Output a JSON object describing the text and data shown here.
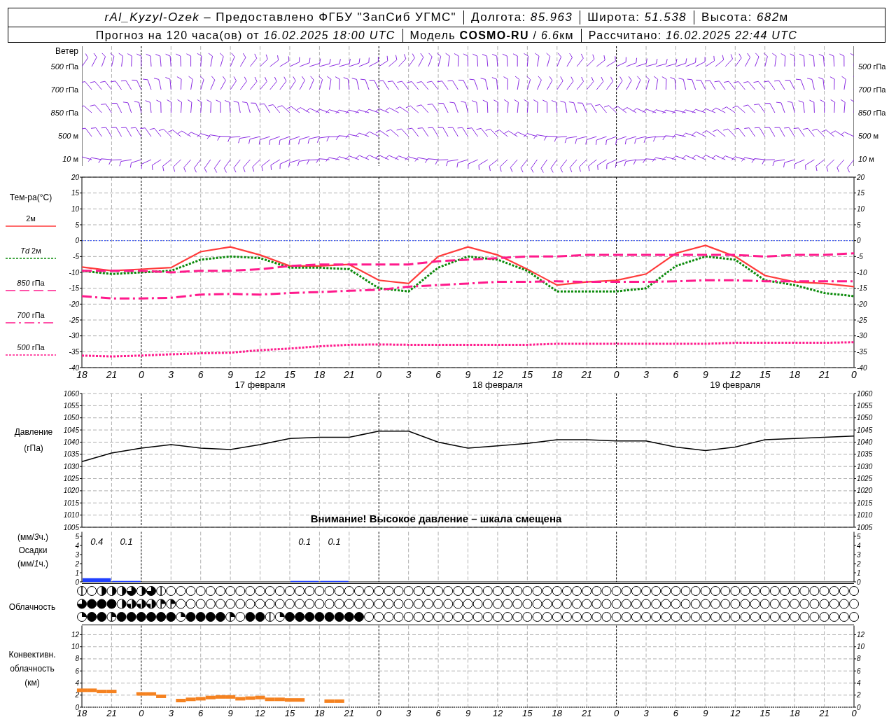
{
  "header": {
    "row1": [
      "*rAl_Kyzyl-Ozek* – Предоставлено ФГБУ \"ЗапСиб УГМС\"",
      "Долгота: *85.963*",
      "Широта: *51.538*",
      [
        "Высота: ",
        "682",
        "м"
      ]
    ],
    "row2": [
      "Прогноз на 120 часа(ов) от *16.02.2025 18:00 UTC*",
      [
        "Модель ",
        "COSMO-RU",
        " / ",
        "6.6",
        "км"
      ],
      "Рассчитано: *16.02.2025 22:44 UTC*"
    ]
  },
  "wind": {
    "title": "Ветер",
    "levels_left": [
      "*500* гПа",
      "*700* гПа",
      "*850* гПа",
      "*500* м",
      "*10* м"
    ],
    "levels_right": [
      "*500* гПа",
      "*700* гПа",
      "*850* гПа",
      "*500* м",
      "*10* м"
    ]
  },
  "temperature": {
    "label": "Тем-ра(°С)",
    "day_labels": [
      "17 февраля",
      "18 февраля",
      "19 февраля"
    ],
    "right_ticks": [
      "20",
      "15",
      "10",
      "5",
      "0",
      "-5",
      "-10",
      "-15",
      "-20",
      "-25",
      "-30",
      "-35",
      "-40"
    ],
    "chart_data": {
      "type": "line",
      "grid": true,
      "ylim": [
        -40,
        20
      ],
      "yticks": [
        20,
        15,
        10,
        5,
        0,
        -5,
        -10,
        -15,
        -20,
        -25,
        -30,
        -35,
        -40
      ],
      "categories": [
        "18",
        "21",
        "0",
        "3",
        "6",
        "9",
        "12",
        "15",
        "18",
        "21",
        "0",
        "3",
        "6",
        "9",
        "12",
        "15",
        "18",
        "21",
        "0",
        "3",
        "6",
        "9",
        "12",
        "15",
        "18",
        "21",
        "0"
      ],
      "series": [
        {
          "name": "2м",
          "line_style": "solid",
          "color": "#ff3b3b",
          "values": [
            -8.3,
            -9.5,
            -9,
            -8.5,
            -3.5,
            -2,
            -4.5,
            -8,
            -8,
            -7.5,
            -12.5,
            -13.5,
            -5,
            -2,
            -4.5,
            -9,
            -14,
            -13,
            -12.5,
            -10.5,
            -4,
            -1.5,
            -5,
            -11,
            -13,
            -13.5,
            -14.5
          ]
        },
        {
          "name": "*Td* 2м",
          "line_style": "dotted",
          "color": "#0a8a0a",
          "values": [
            -9.5,
            -10.5,
            -10,
            -9.5,
            -6,
            -5,
            -5.5,
            -8.5,
            -8.5,
            -9,
            -15,
            -16,
            -8.5,
            -5,
            -6,
            -9.5,
            -16,
            -16,
            -16,
            -15,
            -8,
            -5,
            -6,
            -12.5,
            -14,
            -16.5,
            -17.5
          ]
        },
        {
          "name": "*850* гПа",
          "line_style": "dashed",
          "color": "#ff1a8c",
          "values": [
            -9.5,
            -9.5,
            -9.5,
            -10,
            -9.5,
            -9.5,
            -9,
            -8,
            -7.5,
            -7.5,
            -7.5,
            -7.5,
            -6.5,
            -6,
            -5.5,
            -5,
            -5,
            -4.5,
            -4.5,
            -4.5,
            -4.5,
            -4.5,
            -4.5,
            -5,
            -4.5,
            -4.5,
            -4
          ]
        },
        {
          "name": "*700* гПа",
          "line_style": "dashdot",
          "color": "#ff1a8c",
          "values": [
            -17.5,
            -18.2,
            -18.2,
            -18,
            -17,
            -16.8,
            -17,
            -16.5,
            -16.2,
            -15.8,
            -15.5,
            -14.5,
            -14,
            -13.5,
            -13,
            -13,
            -12.8,
            -13,
            -13,
            -13,
            -12.8,
            -12.5,
            -12.5,
            -12.8,
            -12.8,
            -12.8,
            -12.8
          ]
        },
        {
          "name": "*500* гПа",
          "line_style": "dotted",
          "color": "#ff1a8c",
          "values": [
            -36.2,
            -36.5,
            -36.2,
            -35.8,
            -35.5,
            -35.3,
            -34.5,
            -34,
            -33.3,
            -32.8,
            -32.7,
            -32.8,
            -32.8,
            -32.8,
            -32.8,
            -32.8,
            -32.5,
            -32.5,
            -32.5,
            -32.5,
            -32.5,
            -32.5,
            -32.2,
            -32.2,
            -32.2,
            -32.2,
            -32
          ]
        },
        {
          "line_style": "dotted",
          "color": "#2a4bff",
          "values": [
            0,
            0,
            0,
            0,
            0,
            0,
            0,
            0,
            0,
            0,
            0,
            0,
            0,
            0,
            0,
            0,
            0,
            0,
            0,
            0,
            0,
            0,
            0,
            0,
            0,
            0,
            0
          ]
        }
      ]
    }
  },
  "pressure": {
    "label": "Давление",
    "unit": "(гПа)",
    "warning": "Внимание! Высокое давление – шкала смещена",
    "right_ticks": [
      "1060",
      "1055",
      "1050",
      "1045",
      "1040",
      "1035",
      "1030",
      "1025",
      "1020",
      "1015",
      "1010",
      "1005"
    ],
    "chart_data": {
      "type": "line",
      "grid": true,
      "ylim": [
        1005,
        1060
      ],
      "yticks": [
        1060,
        1055,
        1050,
        1045,
        1040,
        1035,
        1030,
        1025,
        1020,
        1015,
        1010,
        1005
      ],
      "series": [
        {
          "color": "#000000",
          "values": [
            1032,
            1035.5,
            1037.5,
            1039,
            1037.5,
            1037,
            1039,
            1041.5,
            1042,
            1042,
            1044.5,
            1044.5,
            1040,
            1037.5,
            1038.5,
            1039.5,
            1041,
            1041,
            1040.5,
            1040.5,
            1038,
            1036.5,
            1038,
            1041,
            1041.5,
            1042,
            1042.5
          ]
        }
      ]
    }
  },
  "precipitation": {
    "labels": [
      [
        "(мм/",
        "3",
        "ч.)"
      ],
      "Осадки",
      [
        "(мм/",
        "1",
        "ч.)"
      ]
    ],
    "right_ticks": [
      "5",
      "4",
      "3",
      "2",
      "1",
      "0"
    ],
    "chart_data": {
      "type": "bar",
      "grid": true,
      "ylim": [
        0,
        5.5
      ],
      "yticks": [
        5,
        4,
        3,
        2,
        1,
        0
      ],
      "color": "#2040ff",
      "values": [
        0.4,
        0.1,
        0,
        0,
        0,
        0,
        0,
        0.1,
        0.1,
        0,
        0,
        0,
        0,
        0,
        0,
        0,
        0,
        0,
        0,
        0,
        0,
        0,
        0,
        0,
        0,
        0
      ],
      "annotations": [
        "0.4",
        "0.1",
        "0.1",
        "0.1"
      ]
    }
  },
  "cloud": {
    "label": "Облачность",
    "rows": [
      {
        "cells": [
          {
            "kind": "one-eighth"
          },
          {
            "kind": "clear"
          },
          {
            "kind": "half"
          },
          {
            "kind": "five-eighths"
          },
          {
            "kind": "five-eighths"
          },
          {
            "kind": "three-quarters"
          },
          {
            "kind": "five-eighths"
          },
          {
            "kind": "three-quarters"
          },
          {
            "kind": "one-eighth"
          },
          {
            "kind": "clear"
          },
          {
            "kind": "clear"
          },
          {
            "kind": "clear"
          },
          {
            "kind": "clear"
          },
          {
            "kind": "clear"
          },
          {
            "kind": "clear"
          },
          {
            "kind": "clear"
          },
          {
            "kind": "clear"
          },
          {
            "kind": "clear"
          },
          {
            "kind": "clear"
          },
          {
            "kind": "clear"
          },
          {
            "kind": "clear"
          },
          {
            "kind": "clear"
          },
          {
            "kind": "clear"
          },
          {
            "kind": "clear"
          },
          {
            "kind": "clear"
          },
          {
            "kind": "clear"
          },
          {
            "kind": "clear"
          },
          {
            "kind": "clear"
          },
          {
            "kind": "clear"
          },
          {
            "kind": "clear"
          },
          {
            "kind": "clear"
          },
          {
            "kind": "clear"
          },
          {
            "kind": "clear"
          },
          {
            "kind": "clear"
          },
          {
            "kind": "clear"
          },
          {
            "kind": "clear"
          },
          {
            "kind": "clear"
          },
          {
            "kind": "clear"
          },
          {
            "kind": "clear"
          },
          {
            "kind": "clear"
          },
          {
            "kind": "clear"
          },
          {
            "kind": "clear"
          },
          {
            "kind": "clear"
          },
          {
            "kind": "clear"
          },
          {
            "kind": "clear"
          },
          {
            "kind": "clear"
          },
          {
            "kind": "clear"
          },
          {
            "kind": "clear"
          },
          {
            "kind": "clear"
          },
          {
            "kind": "clear"
          },
          {
            "kind": "clear"
          },
          {
            "kind": "clear"
          },
          {
            "kind": "clear"
          },
          {
            "kind": "clear"
          },
          {
            "kind": "clear"
          },
          {
            "kind": "clear"
          },
          {
            "kind": "clear"
          },
          {
            "kind": "clear"
          },
          {
            "kind": "clear"
          },
          {
            "kind": "clear"
          },
          {
            "kind": "clear"
          },
          {
            "kind": "clear"
          },
          {
            "kind": "clear"
          },
          {
            "kind": "clear"
          },
          {
            "kind": "clear"
          },
          {
            "kind": "clear"
          },
          {
            "kind": "clear"
          },
          {
            "kind": "clear"
          },
          {
            "kind": "clear"
          },
          {
            "kind": "clear"
          },
          {
            "kind": "clear"
          },
          {
            "kind": "clear"
          },
          {
            "kind": "clear"
          },
          {
            "kind": "clear"
          },
          {
            "kind": "clear"
          },
          {
            "kind": "clear"
          },
          {
            "kind": "clear"
          },
          {
            "kind": "clear"
          },
          {
            "kind": "clear"
          }
        ]
      },
      {
        "cells": [
          {
            "kind": "three-quarters"
          },
          {
            "kind": "overcast"
          },
          {
            "kind": "overcast"
          },
          {
            "kind": "overcast"
          },
          {
            "kind": "five-eighths"
          },
          {
            "kind": "seven-eighths"
          },
          {
            "kind": "seven-eighths"
          },
          {
            "kind": "seven-eighths"
          },
          {
            "kind": "three-eighths"
          },
          {
            "kind": "three-eighths"
          },
          {
            "kind": "clear"
          },
          {
            "kind": "clear"
          },
          {
            "kind": "clear"
          },
          {
            "kind": "clear"
          },
          {
            "kind": "clear"
          },
          {
            "kind": "clear"
          },
          {
            "kind": "clear"
          },
          {
            "kind": "clear"
          },
          {
            "kind": "clear"
          },
          {
            "kind": "clear"
          },
          {
            "kind": "clear"
          },
          {
            "kind": "clear"
          },
          {
            "kind": "clear"
          },
          {
            "kind": "clear"
          },
          {
            "kind": "clear"
          },
          {
            "kind": "clear"
          },
          {
            "kind": "clear"
          },
          {
            "kind": "clear"
          },
          {
            "kind": "clear"
          },
          {
            "kind": "clear"
          },
          {
            "kind": "clear"
          },
          {
            "kind": "clear"
          },
          {
            "kind": "clear"
          },
          {
            "kind": "clear"
          },
          {
            "kind": "clear"
          },
          {
            "kind": "clear"
          },
          {
            "kind": "clear"
          },
          {
            "kind": "clear"
          },
          {
            "kind": "clear"
          },
          {
            "kind": "clear"
          },
          {
            "kind": "clear"
          },
          {
            "kind": "clear"
          },
          {
            "kind": "clear"
          },
          {
            "kind": "clear"
          },
          {
            "kind": "clear"
          },
          {
            "kind": "clear"
          },
          {
            "kind": "clear"
          },
          {
            "kind": "clear"
          },
          {
            "kind": "clear"
          },
          {
            "kind": "clear"
          },
          {
            "kind": "clear"
          },
          {
            "kind": "clear"
          },
          {
            "kind": "clear"
          },
          {
            "kind": "clear"
          },
          {
            "kind": "clear"
          },
          {
            "kind": "clear"
          },
          {
            "kind": "clear"
          },
          {
            "kind": "clear"
          },
          {
            "kind": "clear"
          },
          {
            "kind": "clear"
          },
          {
            "kind": "clear"
          },
          {
            "kind": "clear"
          },
          {
            "kind": "clear"
          },
          {
            "kind": "clear"
          },
          {
            "kind": "clear"
          },
          {
            "kind": "clear"
          },
          {
            "kind": "clear"
          },
          {
            "kind": "clear"
          },
          {
            "kind": "clear"
          },
          {
            "kind": "clear"
          },
          {
            "kind": "clear"
          },
          {
            "kind": "clear"
          },
          {
            "kind": "clear"
          },
          {
            "kind": "clear"
          },
          {
            "kind": "clear"
          },
          {
            "kind": "clear"
          },
          {
            "kind": "clear"
          },
          {
            "kind": "clear"
          },
          {
            "kind": "clear"
          }
        ]
      },
      {
        "cells": [
          {
            "kind": "quarter"
          },
          {
            "kind": "overcast"
          },
          {
            "kind": "overcast"
          },
          {
            "kind": "three-eighths"
          },
          {
            "kind": "overcast"
          },
          {
            "kind": "overcast"
          },
          {
            "kind": "overcast"
          },
          {
            "kind": "overcast"
          },
          {
            "kind": "overcast"
          },
          {
            "kind": "overcast"
          },
          {
            "kind": "quarter"
          },
          {
            "kind": "overcast"
          },
          {
            "kind": "overcast"
          },
          {
            "kind": "overcast"
          },
          {
            "kind": "overcast"
          },
          {
            "kind": "three-eighths"
          },
          {
            "kind": "clear"
          },
          {
            "kind": "overcast"
          },
          {
            "kind": "overcast"
          },
          {
            "kind": "one-eighth"
          },
          {
            "kind": "quarter"
          },
          {
            "kind": "overcast"
          },
          {
            "kind": "overcast"
          },
          {
            "kind": "overcast"
          },
          {
            "kind": "overcast"
          },
          {
            "kind": "overcast"
          },
          {
            "kind": "overcast"
          },
          {
            "kind": "overcast"
          },
          {
            "kind": "overcast"
          },
          {
            "kind": "clear"
          },
          {
            "kind": "clear"
          },
          {
            "kind": "clear"
          },
          {
            "kind": "clear"
          },
          {
            "kind": "clear"
          },
          {
            "kind": "clear"
          },
          {
            "kind": "clear"
          },
          {
            "kind": "clear"
          },
          {
            "kind": "clear"
          },
          {
            "kind": "clear"
          },
          {
            "kind": "clear"
          },
          {
            "kind": "clear"
          },
          {
            "kind": "clear"
          },
          {
            "kind": "clear"
          },
          {
            "kind": "clear"
          },
          {
            "kind": "clear"
          },
          {
            "kind": "clear"
          },
          {
            "kind": "clear"
          },
          {
            "kind": "clear"
          },
          {
            "kind": "clear"
          },
          {
            "kind": "clear"
          },
          {
            "kind": "clear"
          },
          {
            "kind": "clear"
          },
          {
            "kind": "clear"
          },
          {
            "kind": "clear"
          },
          {
            "kind": "clear"
          },
          {
            "kind": "clear"
          },
          {
            "kind": "clear"
          },
          {
            "kind": "clear"
          },
          {
            "kind": "clear"
          },
          {
            "kind": "clear"
          },
          {
            "kind": "clear"
          },
          {
            "kind": "clear"
          },
          {
            "kind": "clear"
          },
          {
            "kind": "clear"
          },
          {
            "kind": "clear"
          },
          {
            "kind": "clear"
          },
          {
            "kind": "clear"
          },
          {
            "kind": "clear"
          },
          {
            "kind": "clear"
          },
          {
            "kind": "clear"
          },
          {
            "kind": "clear"
          },
          {
            "kind": "clear"
          },
          {
            "kind": "clear"
          },
          {
            "kind": "clear"
          },
          {
            "kind": "clear"
          },
          {
            "kind": "clear"
          },
          {
            "kind": "clear"
          },
          {
            "kind": "clear"
          },
          {
            "kind": "clear"
          }
        ]
      }
    ]
  },
  "convective": {
    "labels": [
      "Конвективн.",
      "облачность",
      "(км)"
    ],
    "right_ticks": [
      "12",
      "10",
      "8",
      "6",
      "4",
      "2",
      "0"
    ],
    "chart_data": {
      "type": "scatter",
      "grid": true,
      "ylim": [
        0,
        13.5
      ],
      "yticks": [
        12,
        10,
        8,
        6,
        4,
        2,
        0
      ],
      "color": "#f58220",
      "categories": [
        "18",
        null,
        null,
        "21",
        null,
        null,
        "0",
        null,
        null,
        "3",
        null,
        null,
        "6",
        null,
        null,
        "9",
        null,
        null,
        "12",
        null,
        null,
        "15",
        null,
        null,
        "18",
        null,
        null,
        "21",
        null,
        null,
        "0",
        null,
        null,
        "3",
        null,
        null,
        "6",
        null,
        null,
        "9",
        null,
        null,
        "12",
        null,
        null,
        "15",
        null,
        null,
        "18",
        null,
        null,
        "21",
        null,
        null,
        "0",
        null,
        null,
        "3",
        null,
        null,
        "6",
        null,
        null,
        "9",
        null,
        null,
        "12",
        null,
        null,
        "15",
        null,
        null,
        "18",
        null,
        null,
        "21",
        null,
        null,
        "0"
      ],
      "values": [
        2.8,
        2.8,
        2.6,
        2.6,
        null,
        null,
        2.2,
        2.2,
        1.8,
        null,
        1.1,
        1.3,
        1.4,
        1.6,
        1.7,
        1.7,
        1.4,
        1.5,
        1.6,
        1.3,
        1.3,
        1.2,
        1.2,
        null,
        null,
        1.0,
        1.0,
        null,
        null,
        null,
        null,
        null,
        null,
        null,
        null,
        null,
        null,
        null,
        null,
        null,
        null,
        null,
        null,
        null,
        null,
        null,
        null,
        null,
        null,
        null,
        null,
        null,
        null,
        null,
        null,
        null,
        null,
        null,
        null,
        null,
        null,
        null,
        null,
        null,
        null,
        null,
        null,
        null,
        null,
        null,
        null,
        null,
        null,
        null,
        null,
        null,
        null,
        null,
        null
      ]
    }
  }
}
